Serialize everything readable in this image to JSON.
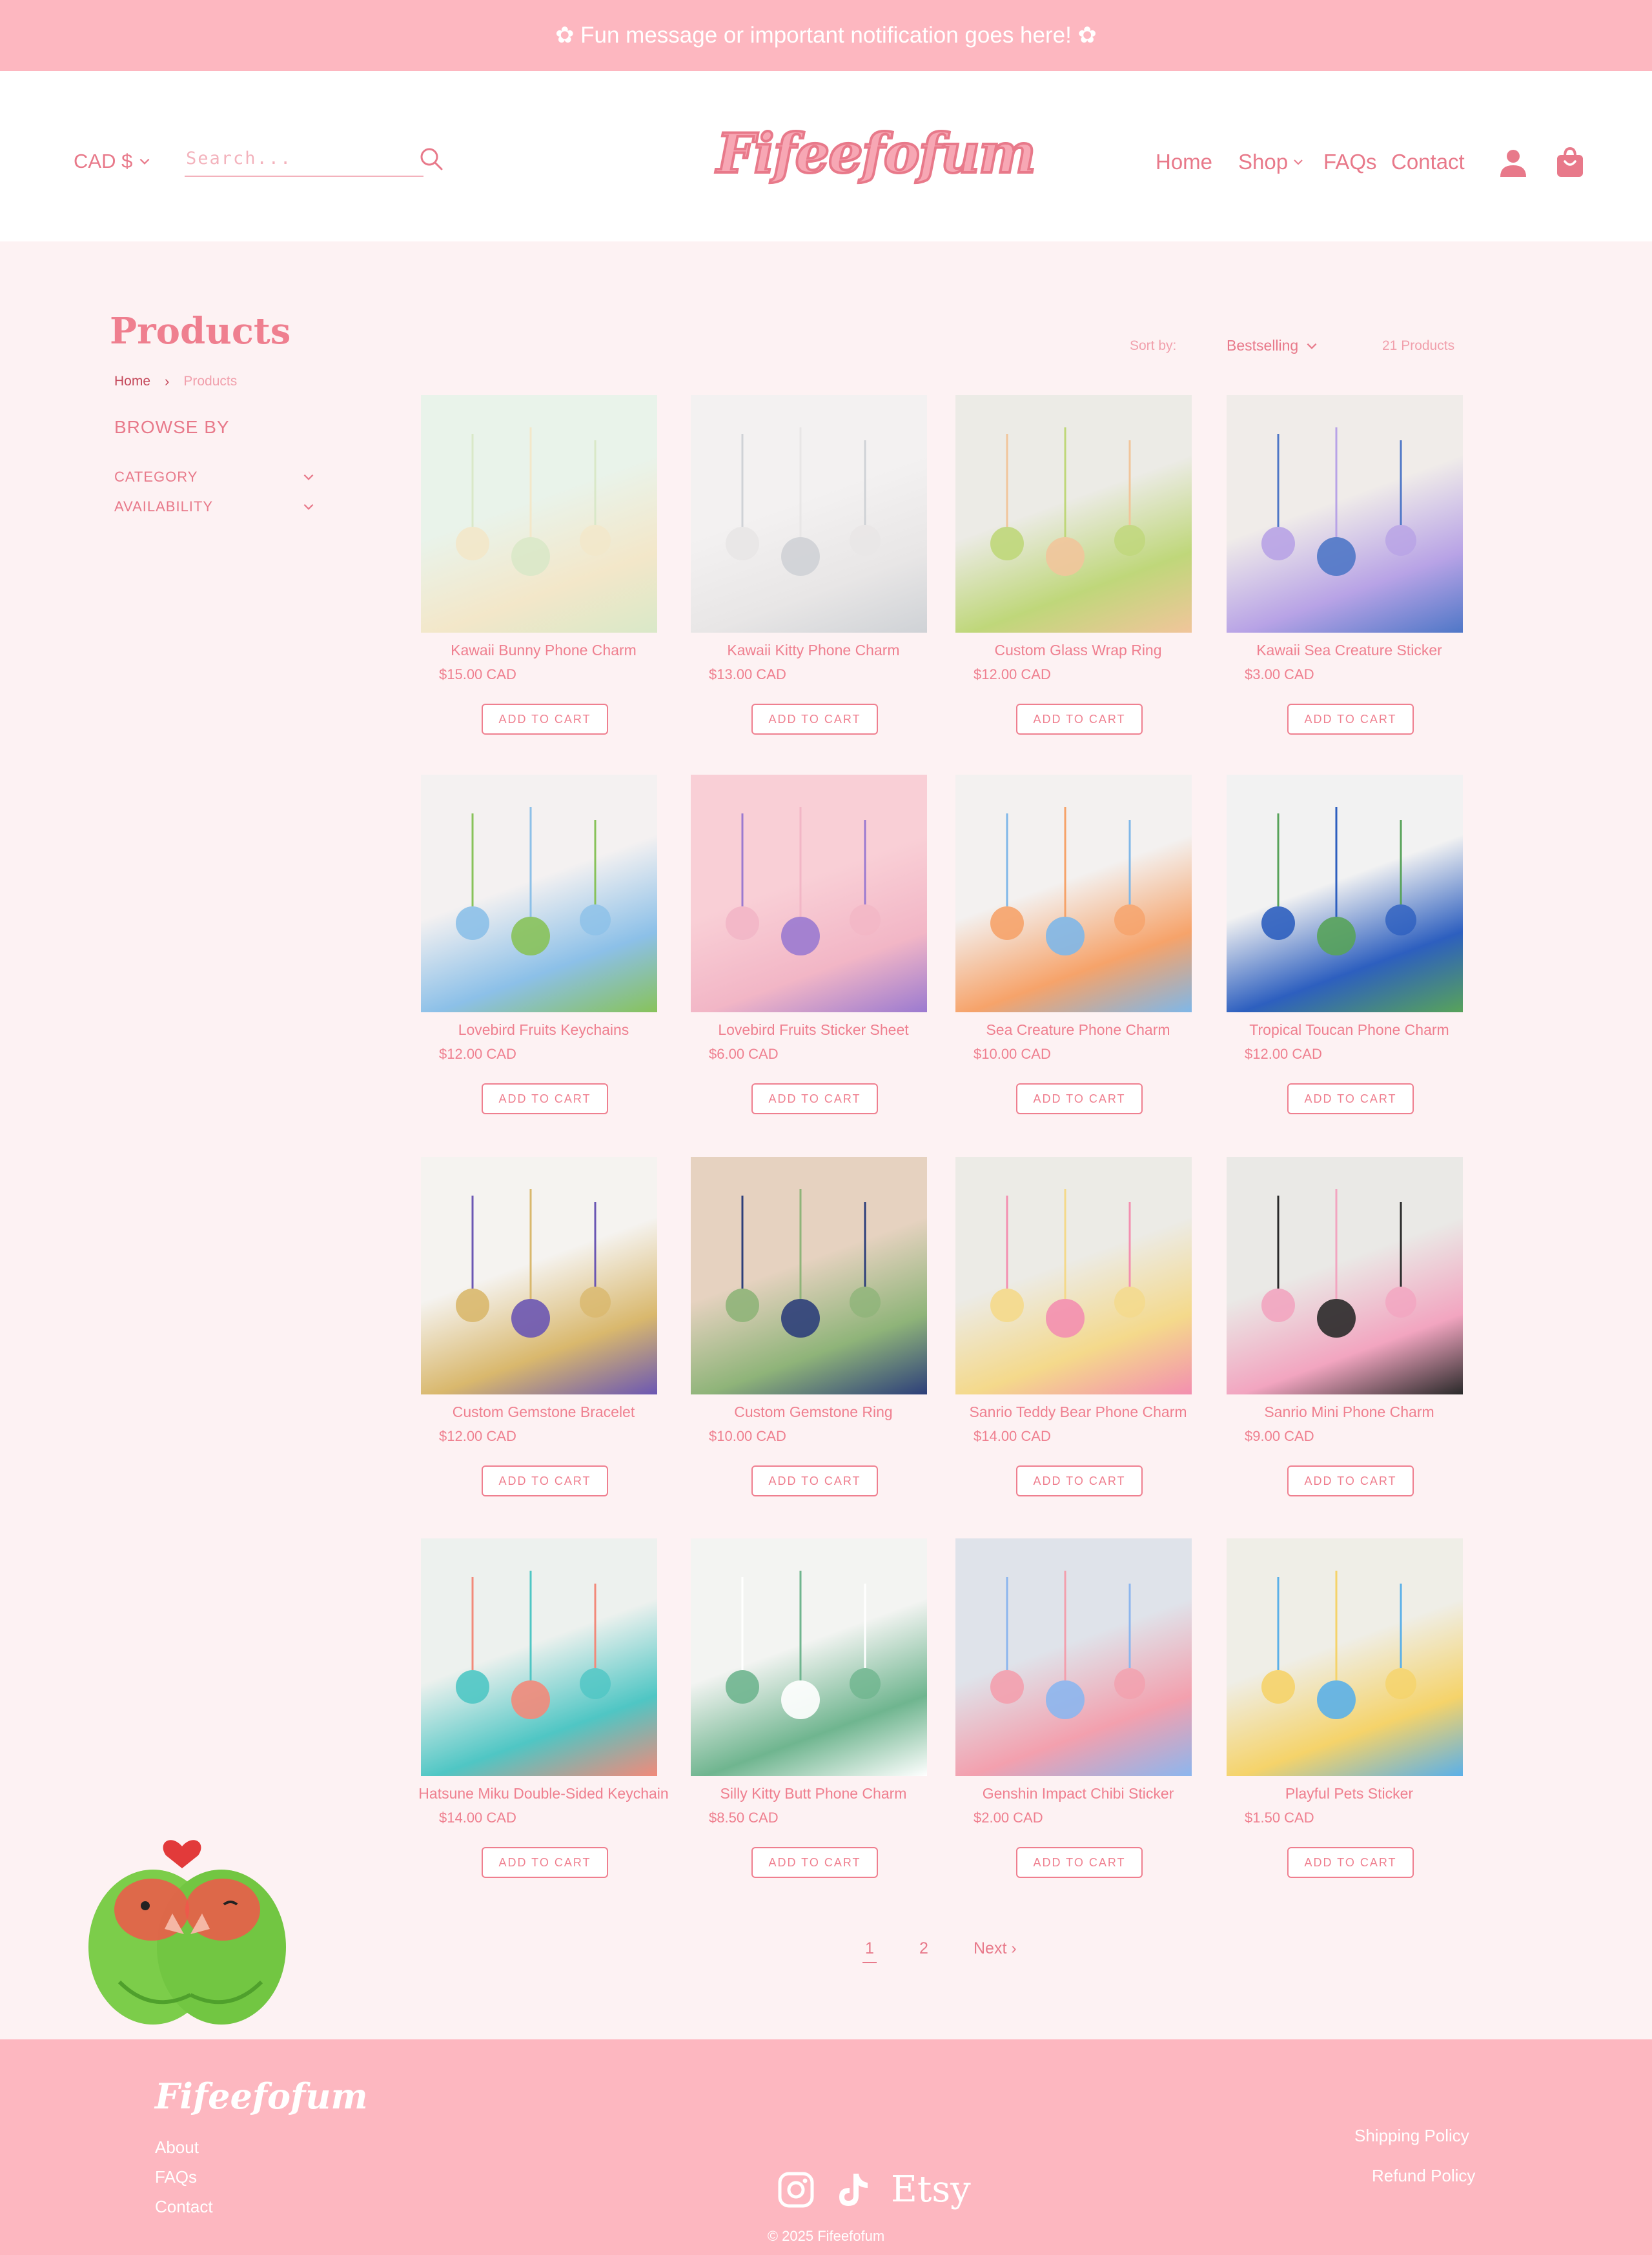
{
  "announcement": "✿ Fun message or important notification goes here! ✿",
  "header": {
    "currency": "CAD $",
    "search_placeholder": "Search...",
    "logo": "Fifeefofum",
    "nav": {
      "home": "Home",
      "shop": "Shop",
      "faqs": "FAQs",
      "contact": "Contact"
    }
  },
  "collection": {
    "title": "Products",
    "breadcrumb": {
      "home": "Home",
      "separator": "›",
      "current": "Products"
    },
    "browse_by": "BROWSE BY",
    "filters": [
      "CATEGORY",
      "AVAILABILITY"
    ],
    "sort_label": "Sort by:",
    "sort_value": "Bestselling",
    "product_count": "21 Products",
    "add_to_cart_label": "ADD TO CART"
  },
  "products": [
    {
      "name": "Kawaii Bunny Phone Charm",
      "price": "$15.00 CAD"
    },
    {
      "name": "Kawaii Kitty Phone Charm",
      "price": "$13.00 CAD"
    },
    {
      "name": "Custom Glass Wrap Ring",
      "price": "$12.00 CAD"
    },
    {
      "name": "Kawaii Sea Creature Sticker",
      "price": "$3.00 CAD"
    },
    {
      "name": "Lovebird Fruits Keychains",
      "price": "$12.00 CAD"
    },
    {
      "name": "Lovebird Fruits Sticker Sheet",
      "price": "$6.00 CAD"
    },
    {
      "name": "Sea Creature Phone Charm",
      "price": "$10.00 CAD"
    },
    {
      "name": "Tropical Toucan Phone Charm",
      "price": "$12.00 CAD"
    },
    {
      "name": "Custom Gemstone Bracelet",
      "price": "$12.00 CAD"
    },
    {
      "name": "Custom Gemstone Ring",
      "price": "$10.00 CAD"
    },
    {
      "name": "Sanrio Teddy Bear Phone Charm",
      "price": "$14.00 CAD"
    },
    {
      "name": "Sanrio Mini Phone Charm",
      "price": "$9.00 CAD"
    },
    {
      "name": "Hatsune Miku Double-Sided Keychain",
      "price": "$14.00 CAD"
    },
    {
      "name": "Silly Kitty Butt Phone Charm",
      "price": "$8.50 CAD"
    },
    {
      "name": "Genshin Impact Chibi Sticker",
      "price": "$2.00 CAD"
    },
    {
      "name": "Playful Pets Sticker",
      "price": "$1.50 CAD"
    }
  ],
  "pagination": {
    "pages": [
      "1",
      "2"
    ],
    "current": "1",
    "next": "Next ›"
  },
  "footer": {
    "logo": "Fifeefofum",
    "links": [
      "About",
      "FAQs",
      "Contact"
    ],
    "policies": [
      "Shipping Policy",
      "Refund Policy"
    ],
    "etsy": "Etsy",
    "copyright": "© 2025 Fifeefofum"
  },
  "colors": {
    "accent": "#e8798a",
    "banner": "#fdb7c0",
    "page_bg": "#fdf2f3"
  }
}
